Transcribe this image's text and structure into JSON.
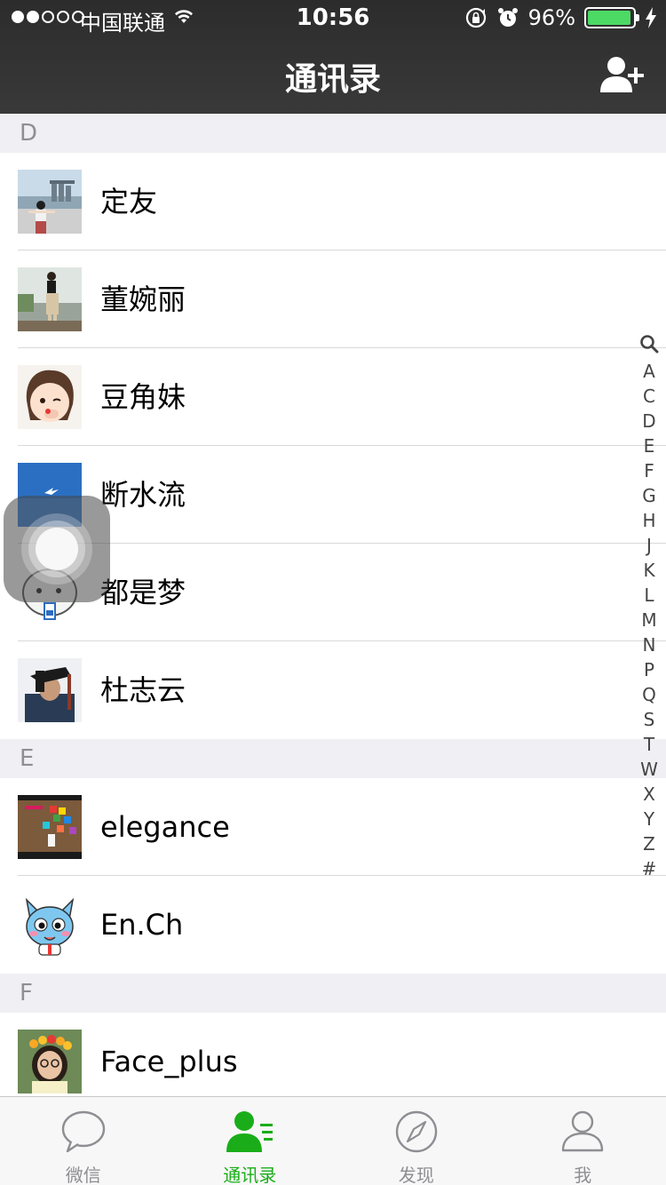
{
  "status_bar": {
    "carrier": "中国联通",
    "time": "10:56",
    "battery_percent": "96%",
    "battery_level": 0.96,
    "signal_filled": 2,
    "signal_total": 5
  },
  "nav": {
    "title": "通讯录",
    "add_contact_icon": "add-contact-icon"
  },
  "sections": [
    {
      "letter": "D",
      "contacts": [
        {
          "name": "定友",
          "avatar": "photo-waterfront"
        },
        {
          "name": "董婉丽",
          "avatar": "photo-woman-standing"
        },
        {
          "name": "豆角妹",
          "avatar": "photo-cartoon-girl"
        },
        {
          "name": "断水流",
          "avatar": "photo-bird-sky"
        },
        {
          "name": "都是梦",
          "avatar": "cartoon-face"
        },
        {
          "name": "杜志云",
          "avatar": "photo-man-hat"
        }
      ]
    },
    {
      "letter": "E",
      "contacts": [
        {
          "name": "elegance",
          "avatar": "photo-colorful-wall"
        },
        {
          "name": "En.Ch",
          "avatar": "cartoon-cat"
        }
      ]
    },
    {
      "letter": "F",
      "contacts": [
        {
          "name": "Face_plus",
          "avatar": "photo-flower-crown"
        }
      ]
    }
  ],
  "index_bar": [
    "A",
    "C",
    "D",
    "E",
    "F",
    "G",
    "H",
    "J",
    "K",
    "L",
    "M",
    "N",
    "P",
    "Q",
    "S",
    "T",
    "W",
    "X",
    "Y",
    "Z",
    "#"
  ],
  "tabs": [
    {
      "label": "微信",
      "icon": "chat-bubble-icon",
      "active": false
    },
    {
      "label": "通讯录",
      "icon": "contacts-icon",
      "active": true
    },
    {
      "label": "发现",
      "icon": "compass-icon",
      "active": false
    },
    {
      "label": "我",
      "icon": "profile-icon",
      "active": false
    }
  ],
  "colors": {
    "nav_bg": "#393939",
    "accent_green": "#1aad19",
    "section_bg": "#efeff4",
    "battery_green": "#4cd964"
  }
}
